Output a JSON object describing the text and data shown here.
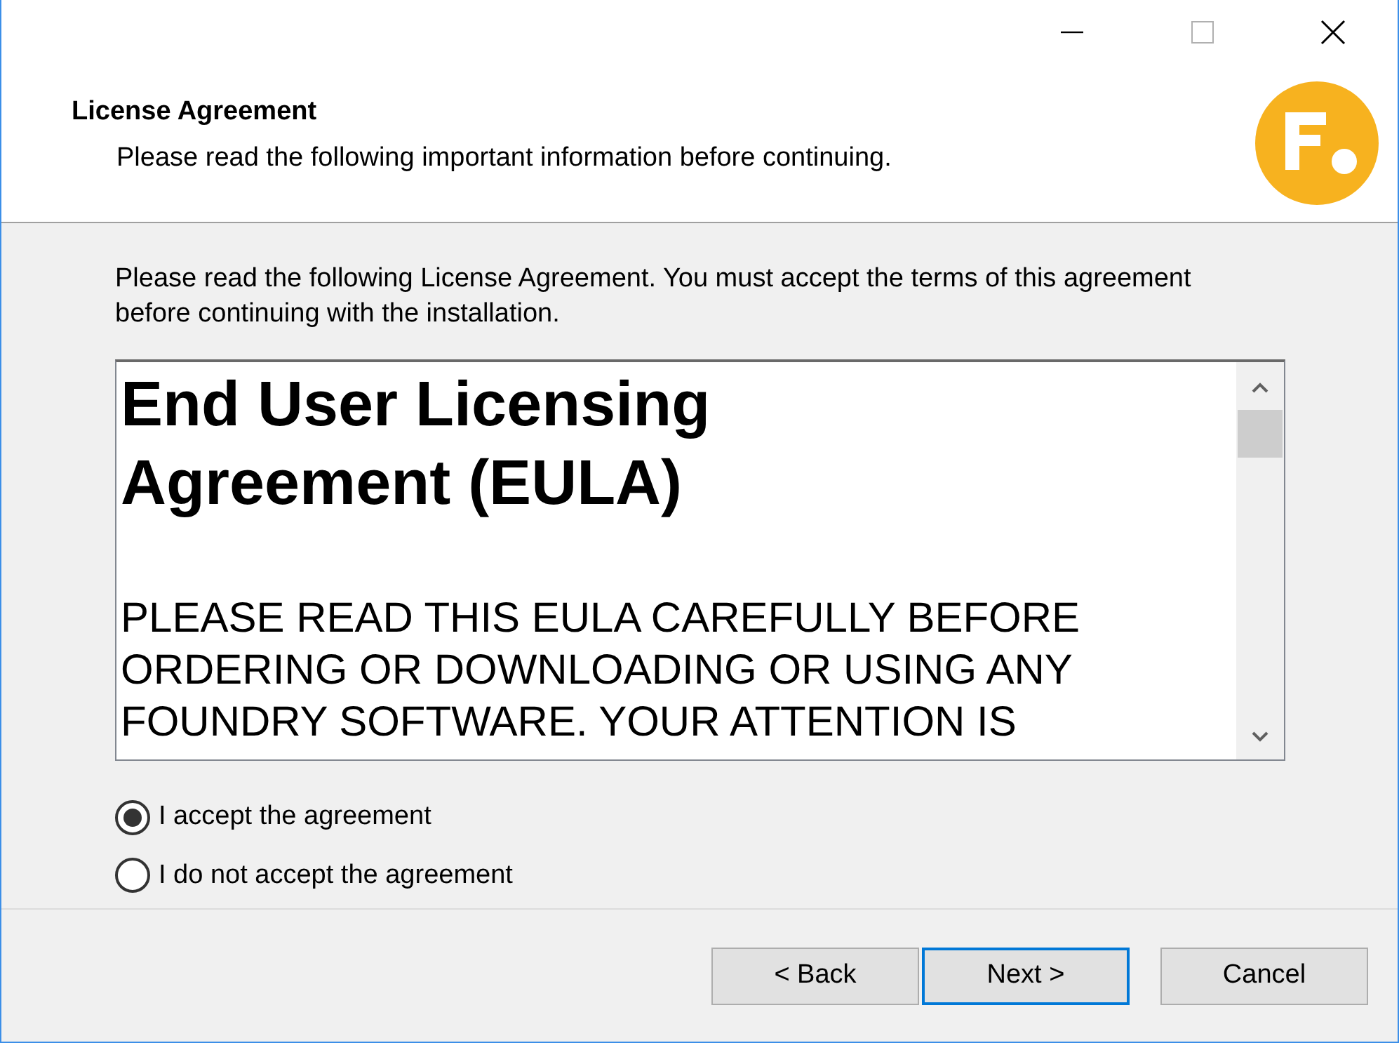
{
  "header": {
    "title": "License Agreement",
    "subtitle": "Please read the following important information before continuing."
  },
  "intro": "Please read the following License Agreement. You must accept the terms of this agreement before continuing with the installation.",
  "license_text": {
    "heading": "End User Licensing Agreement (EULA)",
    "body": "PLEASE READ THIS EULA CAREFULLY BEFORE ORDERING OR DOWNLOADING OR USING ANY FOUNDRY SOFTWARE. YOUR ATTENTION IS"
  },
  "options": [
    {
      "label": "I accept the agreement",
      "selected": true
    },
    {
      "label": "I do not accept the agreement",
      "selected": false
    }
  ],
  "buttons": [
    {
      "label": "< Back",
      "default": false
    },
    {
      "label": "Next >",
      "default": true
    },
    {
      "label": "Cancel",
      "default": false
    }
  ]
}
